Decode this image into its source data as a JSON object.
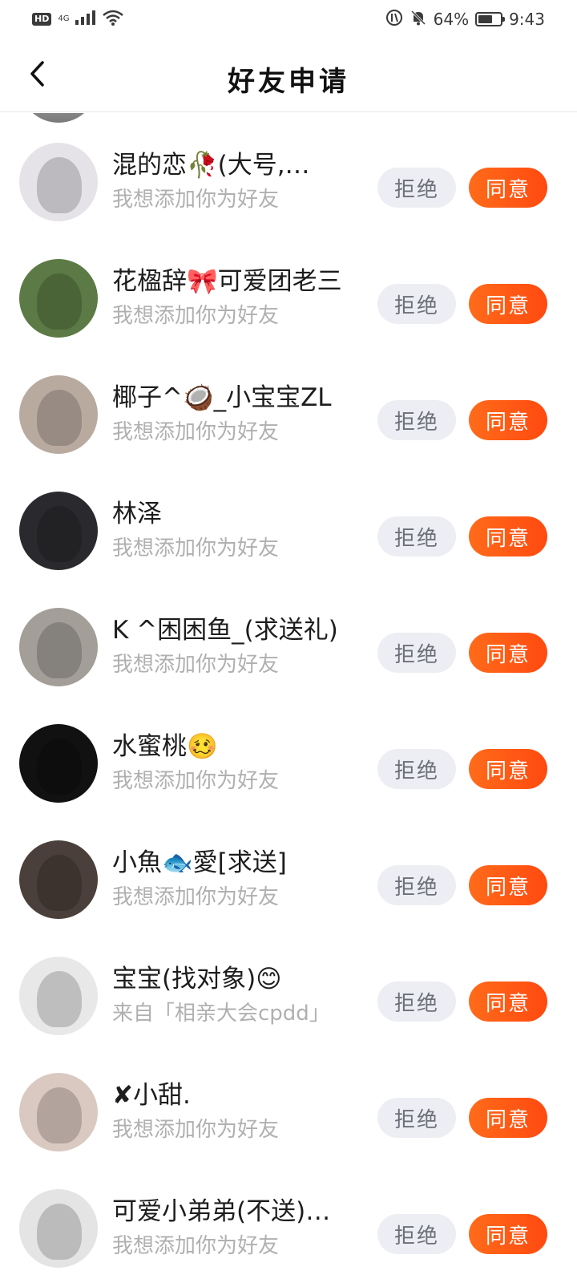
{
  "status_bar": {
    "hd": "HD",
    "network": "4G",
    "battery_percent": "64%",
    "battery_level": 0.64,
    "time": "9:43"
  },
  "header": {
    "title": "好友申请",
    "back_icon": "chevron-left-icon"
  },
  "requests": [
    {
      "name": "混的恋🥀(大号,…",
      "subtitle": "我想添加你为好友",
      "reject": "拒绝",
      "accept": "同意",
      "avatar_color": "#e6e3e8"
    },
    {
      "name": "花楹辞🎀可爱团老三",
      "subtitle": "我想添加你为好友",
      "reject": "拒绝",
      "accept": "同意",
      "avatar_color": "#5b7a45"
    },
    {
      "name": "椰子^🥥_小宝宝ZL",
      "subtitle": "我想添加你为好友",
      "reject": "拒绝",
      "accept": "同意",
      "avatar_color": "#b9aaa0"
    },
    {
      "name": "林泽",
      "subtitle": "我想添加你为好友",
      "reject": "拒绝",
      "accept": "同意",
      "avatar_color": "#2a2a2e"
    },
    {
      "name": "K ^困困鱼_(求送礼)",
      "subtitle": "我想添加你为好友",
      "reject": "拒绝",
      "accept": "同意",
      "avatar_color": "#a39e98"
    },
    {
      "name": "水蜜桃🥴",
      "subtitle": "我想添加你为好友",
      "reject": "拒绝",
      "accept": "同意",
      "avatar_color": "#111111"
    },
    {
      "name": "小魚🐟愛[求送]",
      "subtitle": "我想添加你为好友",
      "reject": "拒绝",
      "accept": "同意",
      "avatar_color": "#4a3f3a"
    },
    {
      "name": "宝宝(找对象)😊",
      "subtitle": "来自「相亲大会cpdd」",
      "reject": "拒绝",
      "accept": "同意",
      "avatar_color": "#e8e8e8"
    },
    {
      "name": "✘小甜.",
      "subtitle": "我想添加你为好友",
      "reject": "拒绝",
      "accept": "同意",
      "avatar_color": "#d9c9c0"
    },
    {
      "name": "可爱小弟弟(不送)…",
      "subtitle": "我想添加你为好友",
      "reject": "拒绝",
      "accept": "同意",
      "avatar_color": "#e4e4e4"
    }
  ]
}
